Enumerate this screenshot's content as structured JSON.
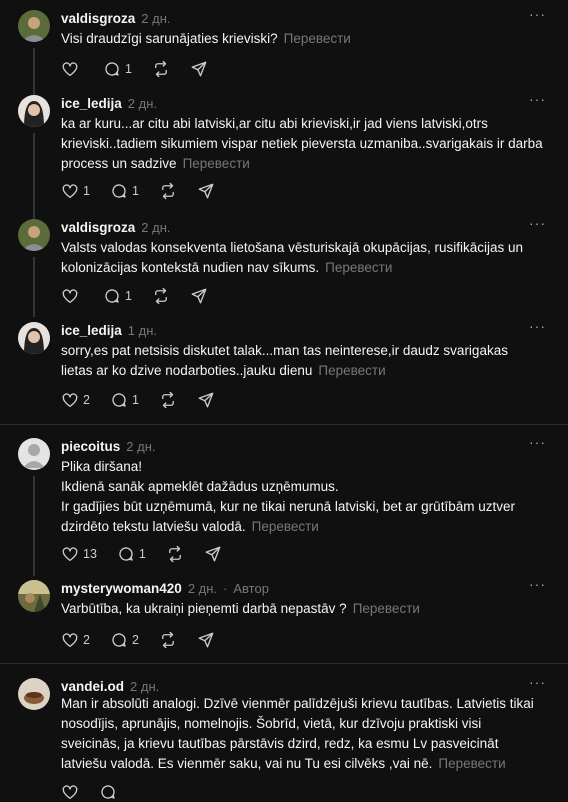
{
  "ui": {
    "more_glyph": "···",
    "translate_label": "Перевести"
  },
  "posts": [
    {
      "username": "valdisgroza",
      "time": "2 дн.",
      "author_tag": "",
      "lines": [
        "Visi draudzīgi sarunājaties krieviski?"
      ],
      "likes": "",
      "replies": "1"
    },
    {
      "username": "ice_ledija",
      "time": "2 дн.",
      "author_tag": "",
      "lines": [
        "ka ar kuru...ar citu abi latviski,ar citu abi krieviski,ir jad viens latviski,otrs krieviski..tadiem sikumiem vispar netiek pieversta uzmaniba..svarigakais ir darba process un sadzive"
      ],
      "likes": "1",
      "replies": "1"
    },
    {
      "username": "valdisgroza",
      "time": "2 дн.",
      "author_tag": "",
      "lines": [
        "Valsts valodas konsekventa lietošana vēsturiskajā okupācijas, rusifikācijas un kolonizācijas kontekstā nudien nav sīkums."
      ],
      "likes": "",
      "replies": "1"
    },
    {
      "username": "ice_ledija",
      "time": "1 дн.",
      "author_tag": "",
      "lines": [
        "sorry,es pat netsisis diskutet talak...man tas neinterese,ir daudz svarigakas lietas ar ko dzive nodarboties..jauku dienu"
      ],
      "likes": "2",
      "replies": "1"
    },
    {
      "username": "piecoitus",
      "time": "2 дн.",
      "author_tag": "",
      "lines": [
        "Plika diršana!",
        "Ikdienā sanāk apmeklēt dažādus uzņēmumus.",
        "Ir gadījies būt uzņēmumā, kur ne tikai nerunā latviski, bet ar grūtībām uztver dzirdēto tekstu latviešu valodā."
      ],
      "likes": "13",
      "replies": "1"
    },
    {
      "username": "mysterywoman420",
      "time": "2 дн.",
      "author_tag": "Автор",
      "lines": [
        "Varbūtība, ka ukraiņi pieņemti darbā nepastāv ?"
      ],
      "likes": "2",
      "replies": "2"
    },
    {
      "username": "vandei.od",
      "time": "2 дн.",
      "author_tag": "",
      "lines": [
        "Man ir absolūti analogi. Dzīvē vienmēr palīdzējuši krievu tautības. Latvietis tikai nosodījis, aprunājis, nomelnojis. Šobrīd, vietā, kur dzīvoju praktiski visi sveicinās, ja krievu tautības pārstāvis dzird, redz, ka esmu Lv pasveicināt latviešu valodā. Es vienmēr saku, vai nu Tu esi cilvēks ,vai nē."
      ],
      "likes": "",
      "replies": ""
    }
  ]
}
